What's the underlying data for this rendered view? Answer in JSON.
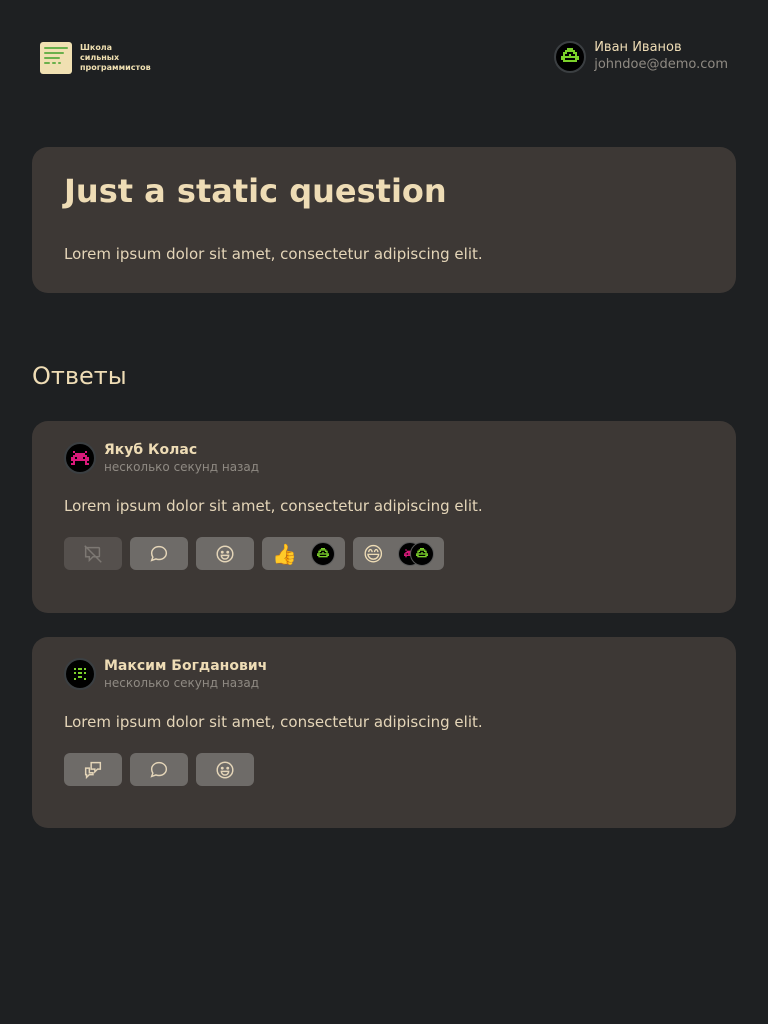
{
  "header": {
    "logo_lines": [
      "Школа",
      "сильных",
      "программистов"
    ],
    "user": {
      "name": "Иван Иванов",
      "email": "johndoe@demo.com",
      "avatar_icon": "green-pixel-monster-icon"
    }
  },
  "question": {
    "title": "Just a static question",
    "body": "Lorem ipsum dolor sit amet, consectetur adipiscing elit."
  },
  "answers_heading": "Ответы",
  "answers": [
    {
      "author": "Якуб Колас",
      "time": "несколько секунд назад",
      "body": "Lorem ipsum dolor sit amet, consectetur adipiscing elit.",
      "avatar_icon": "pink-pixel-monster-icon",
      "reactions": [
        {
          "emoji": "👍",
          "users": [
            "green-pixel-monster-icon"
          ]
        },
        {
          "emoji": "😄",
          "users": [
            "pink-pixel-monster-icon",
            "green-pixel-monster-icon"
          ]
        }
      ]
    },
    {
      "author": "Максим Богданович",
      "time": "несколько секунд назад",
      "body": "Lorem ipsum dolor sit amet, consectetur adipiscing elit.",
      "avatar_icon": "green-dots-monster-icon",
      "reactions": []
    }
  ],
  "colors": {
    "background": "#1e2022",
    "card": "#3d3835",
    "text": "#eedcb5",
    "muted": "#8f8a83",
    "button": "#6e6b68",
    "accent_green": "#7bd12a",
    "accent_pink": "#d9197a"
  }
}
